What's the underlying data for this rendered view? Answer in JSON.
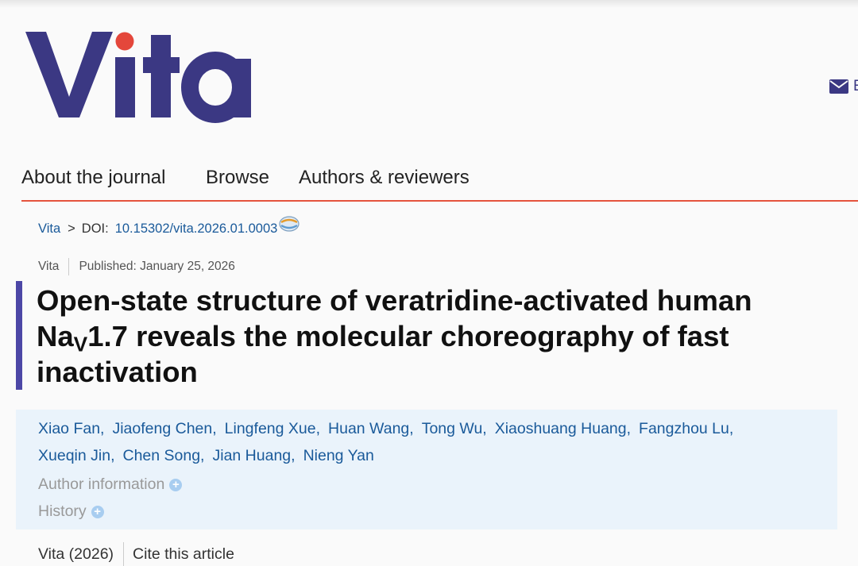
{
  "brand": {
    "logo_text": "Vita",
    "logo_color": "#3b3883",
    "dot_color": "#e4473b"
  },
  "header": {
    "email_label": "E",
    "email_icon": "envelope-icon"
  },
  "nav": {
    "items": [
      "About the journal",
      "Browse",
      "Authors & reviewers"
    ],
    "underline_color": "#e5533d"
  },
  "breadcrumb": {
    "journal": "Vita",
    "separator": ">",
    "doi_label": "DOI:",
    "doi": "10.15302/vita.2026.01.0003",
    "doi_icon": "crossref-icon"
  },
  "meta": {
    "journal": "Vita",
    "published": "Published: January 25, 2026"
  },
  "article": {
    "title_part1": "Open-state structure of veratridine-activated human Na",
    "title_sub": "V",
    "title_part2": "1.7 reveals the molecular choreography of fast inactivation",
    "accent_color": "#4c47a6"
  },
  "authors": {
    "line1": [
      "Xiao Fan,",
      "Jiaofeng Chen,",
      "Lingfeng Xue,",
      "Huan Wang,",
      "Tong Wu,",
      "Xiaoshuang Huang,",
      "Fangzhou Lu,"
    ],
    "line2": [
      "Xueqin Jin,",
      "Chen Song,",
      "Jian Huang,",
      "Nieng Yan"
    ],
    "author_information": "Author information",
    "history": "History",
    "expand_icon": "plus-circle-icon"
  },
  "footer": {
    "citation": "Vita (2026)",
    "cite_label": "Cite this article"
  }
}
